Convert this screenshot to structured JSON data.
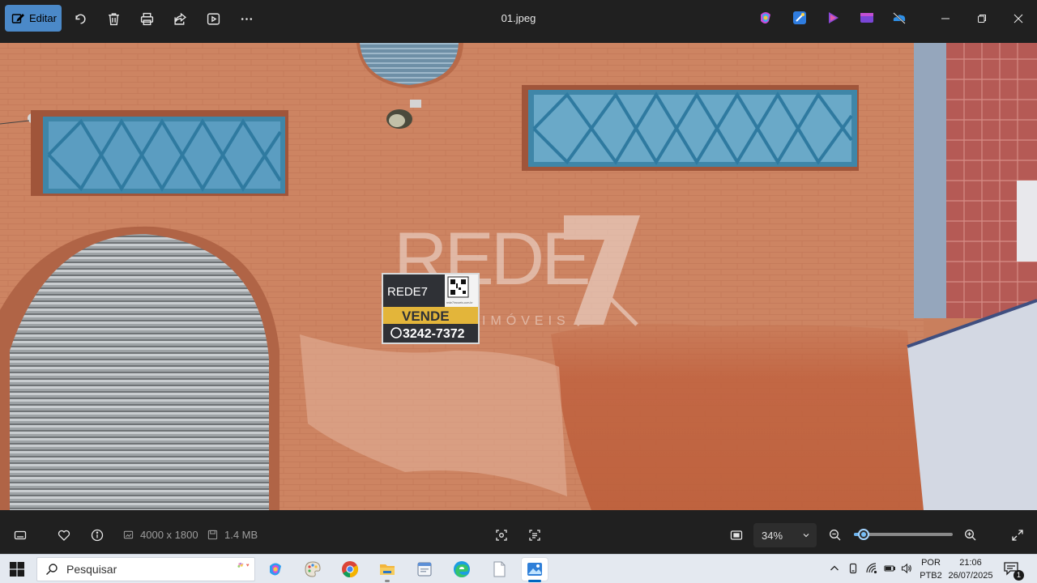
{
  "toolbar": {
    "edit_label": "Editar",
    "filename": "01.jpeg",
    "icons": [
      "edit-icon",
      "rotate-icon",
      "delete-icon",
      "print-icon",
      "share-icon",
      "slideshow-icon",
      "more-icon"
    ],
    "extensions": [
      "copilot-icon",
      "designer-icon",
      "clipchamp-icon",
      "video-editor-icon",
      "onedrive-icon"
    ]
  },
  "photo": {
    "sign": {
      "brand": "REDE7",
      "action": "VENDE",
      "phone": "3242-7372",
      "url": "rede7imoveis.com.br"
    },
    "watermark": {
      "brand": "REDE",
      "digit": "7",
      "tagline": "IMÓVEIS"
    }
  },
  "statusbar": {
    "dimensions": "4000 x 1800",
    "filesize": "1.4 MB",
    "zoom": "34%",
    "zoom_fraction": 0.1
  },
  "taskbar": {
    "search_placeholder": "Pesquisar",
    "language_line1": "POR",
    "language_line2": "PTB2",
    "time": "21:06",
    "date": "26/07/2025",
    "notification_count": "1"
  },
  "colors": {
    "accent": "#4b89c8",
    "wall": "#c97f5d",
    "window_frame": "#3f86a8",
    "sign_yellow": "#e3b53a",
    "sign_dark": "#2f3136"
  }
}
